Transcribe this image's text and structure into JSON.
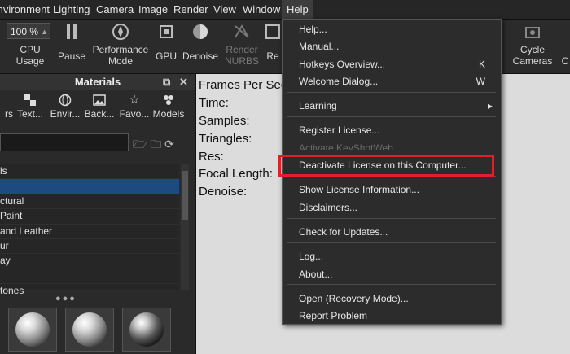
{
  "menubar": {
    "items": [
      "Environment",
      "Lighting",
      "Camera",
      "Image",
      "Render",
      "View",
      "Window",
      "Help"
    ]
  },
  "toolbar": {
    "zoom_value": "100 %",
    "buttons": [
      "CPU Usage",
      "Pause",
      "Performance Mode",
      "GPU",
      "Denoise",
      "Render NURBS",
      "Re",
      "Cycle Cameras",
      "C"
    ]
  },
  "materials_panel": {
    "title": "Materials",
    "categories": [
      "rs",
      "Text...",
      "Envir...",
      "Back...",
      "Favo...",
      "Models"
    ],
    "tree_items": [
      "ls",
      "",
      "ctural",
      "Paint",
      "and Leather",
      "ur",
      "ay",
      "",
      "tones"
    ]
  },
  "hud": {
    "frames_per_second": "Frames Per Sec",
    "time": "Time:",
    "samples": "Samples:",
    "triangles": "Triangles:",
    "res": "Res:",
    "focal_length": "Focal Length:",
    "denoise": "Denoise:"
  },
  "help_menu": {
    "items": [
      {
        "label": "Help...",
        "shortcut": ""
      },
      {
        "label": "Manual...",
        "shortcut": ""
      },
      {
        "label": "Hotkeys Overview...",
        "shortcut": "K"
      },
      {
        "label": "Welcome Dialog...",
        "shortcut": "W"
      },
      {
        "label": "Learning",
        "shortcut": ""
      },
      {
        "label": "Register License...",
        "shortcut": ""
      },
      {
        "label": "Activate KeyShotWeb...",
        "shortcut": ""
      },
      {
        "label": "Deactivate License on this Computer...",
        "shortcut": ""
      },
      {
        "label": "Show License Information...",
        "shortcut": ""
      },
      {
        "label": "Disclaimers...",
        "shortcut": ""
      },
      {
        "label": "Check for Updates...",
        "shortcut": ""
      },
      {
        "label": "Log...",
        "shortcut": ""
      },
      {
        "label": "About...",
        "shortcut": ""
      },
      {
        "label": "Open (Recovery Mode)...",
        "shortcut": ""
      },
      {
        "label": "Report Problem",
        "shortcut": ""
      }
    ],
    "submenu_arrow": "▸",
    "highlight_color": "#e11f2a"
  }
}
